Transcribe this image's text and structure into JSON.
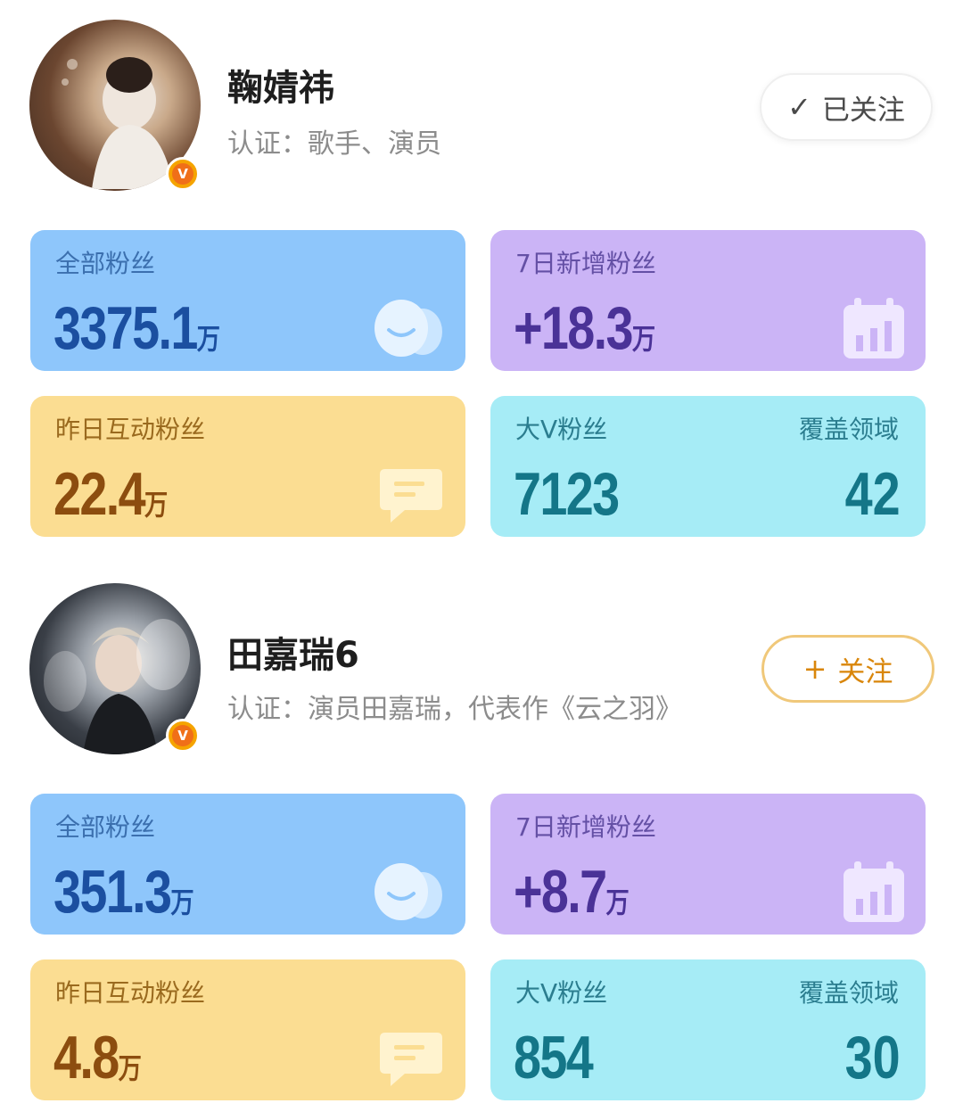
{
  "profiles": [
    {
      "name": "鞠婧祎",
      "certification": "认证：歌手、演员",
      "verified_badge": "V",
      "follow_button": {
        "state": "followed",
        "icon": "check-icon",
        "label": "已关注",
        "icon_glyph": "✓"
      },
      "stats": {
        "total_fans": {
          "label": "全部粉丝",
          "value": "3375.1",
          "unit": "万"
        },
        "new_fans_7d": {
          "label": "7日新增粉丝",
          "value": "+18.3",
          "unit": "万"
        },
        "yesterday_interactive_fans": {
          "label": "昨日互动粉丝",
          "value": "22.4",
          "unit": "万"
        },
        "big_v_fans": {
          "label": "大V粉丝",
          "value": "7123"
        },
        "coverage_fields": {
          "label": "覆盖领域",
          "value": "42"
        }
      }
    },
    {
      "name": "田嘉瑞6",
      "certification": "认证：演员田嘉瑞，代表作《云之羽》",
      "verified_badge": "V",
      "follow_button": {
        "state": "not-followed",
        "icon": "plus-icon",
        "label": "关注",
        "icon_glyph": "+"
      },
      "stats": {
        "total_fans": {
          "label": "全部粉丝",
          "value": "351.3",
          "unit": "万"
        },
        "new_fans_7d": {
          "label": "7日新增粉丝",
          "value": "+8.7",
          "unit": "万"
        },
        "yesterday_interactive_fans": {
          "label": "昨日互动粉丝",
          "value": "4.8",
          "unit": "万"
        },
        "big_v_fans": {
          "label": "大V粉丝",
          "value": "854"
        },
        "coverage_fields": {
          "label": "覆盖领域",
          "value": "30"
        }
      }
    }
  ],
  "colors": {
    "blue_card": "#8ec6fb",
    "purple_card": "#cbb4f6",
    "yellow_card": "#fbdd92",
    "cyan_card": "#a6ecf6",
    "follow_accent": "#d9860a",
    "badge": "#f06f18"
  }
}
